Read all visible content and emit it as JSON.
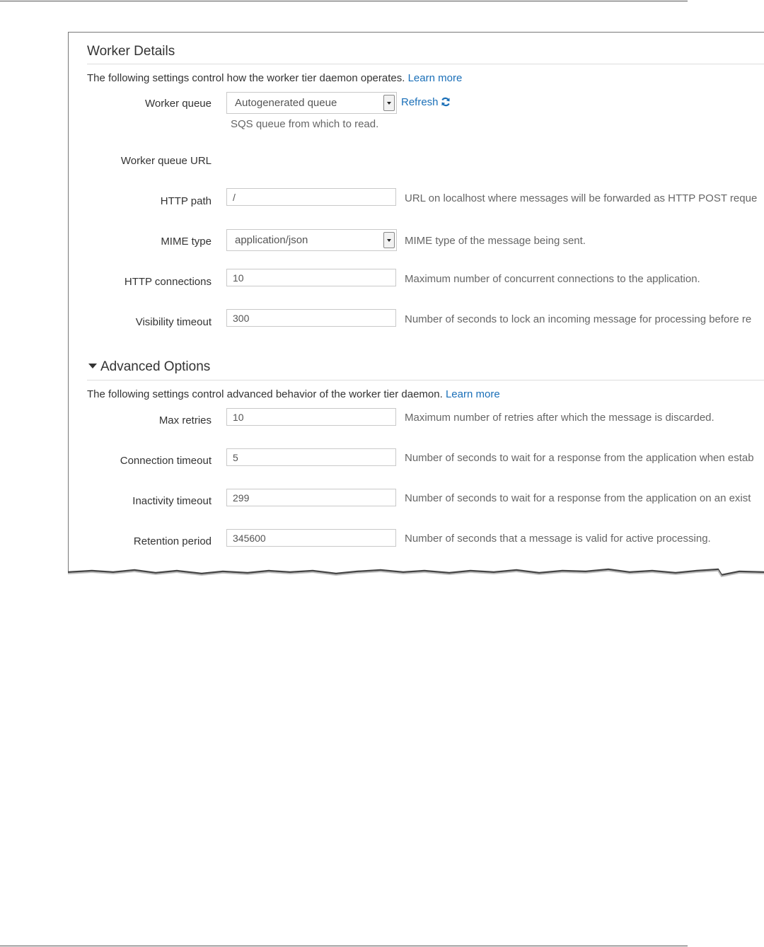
{
  "worker_details": {
    "title": "Worker Details",
    "description": "The following settings control how the worker tier daemon operates.",
    "learn_more": "Learn more",
    "worker_queue": {
      "label": "Worker queue",
      "value": "Autogenerated queue",
      "refresh": "Refresh",
      "help": "SQS queue from which to read."
    },
    "worker_queue_url": {
      "label": "Worker queue URL"
    },
    "http_path": {
      "label": "HTTP path",
      "value": "/",
      "help": "URL on localhost where messages will be forwarded as HTTP POST reque"
    },
    "mime_type": {
      "label": "MIME type",
      "value": "application/json",
      "help": "MIME type of the message being sent."
    },
    "http_connections": {
      "label": "HTTP connections",
      "value": "10",
      "help": "Maximum number of concurrent connections to the application."
    },
    "visibility_timeout": {
      "label": "Visibility timeout",
      "value": "300",
      "help": "Number of seconds to lock an incoming message for processing before re"
    }
  },
  "advanced_options": {
    "title": "Advanced Options",
    "description": "The following settings control advanced behavior of the worker tier daemon.",
    "learn_more": "Learn more",
    "max_retries": {
      "label": "Max retries",
      "value": "10",
      "help": "Maximum number of retries after which the message is discarded."
    },
    "connection_timeout": {
      "label": "Connection timeout",
      "value": "5",
      "help": "Number of seconds to wait for a response from the application when estab"
    },
    "inactivity_timeout": {
      "label": "Inactivity timeout",
      "value": "299",
      "help": "Number of seconds to wait for a response from the application on an exist"
    },
    "retention_period": {
      "label": "Retention period",
      "value": "345600",
      "help": "Number of seconds that a message is valid for active processing."
    }
  },
  "colors": {
    "link": "#1a6fb8",
    "text": "#333333",
    "help_text": "#666666",
    "border": "#c9c9c9"
  }
}
